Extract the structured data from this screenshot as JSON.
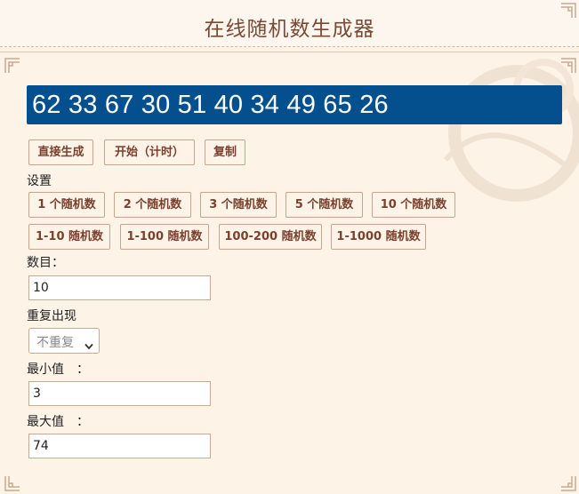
{
  "header": {
    "title": "在线随机数生成器"
  },
  "display": {
    "numbers": "62 33 67 30 51 40 34 49 65 26"
  },
  "actions": {
    "generate_label": "直接生成",
    "start_label": "开始（计时）",
    "copy_label": "复制"
  },
  "settings": {
    "label": "设置",
    "count_presets": [
      "1 个随机数",
      "2 个随机数",
      "3 个随机数",
      "5 个随机数",
      "10 个随机数"
    ],
    "range_presets": [
      "1-10 随机数",
      "1-100 随机数",
      "100-200 随机数",
      "1-1000 随机数"
    ]
  },
  "form": {
    "count_label": "数目：",
    "count_value": "10",
    "repeat_label": "重复出现",
    "repeat_selected": "不重复",
    "min_label": "最小值　：",
    "min_value": "3",
    "max_label": "最大值　：",
    "max_value": "74"
  },
  "icons": {
    "corner": "ornament-corner-icon",
    "dropdown": "chevron-down-icon"
  },
  "colors": {
    "display_bg": "#04508f",
    "title": "#7a4a35",
    "button_text": "#7a4030",
    "page_bg": "#fdf3e6"
  }
}
